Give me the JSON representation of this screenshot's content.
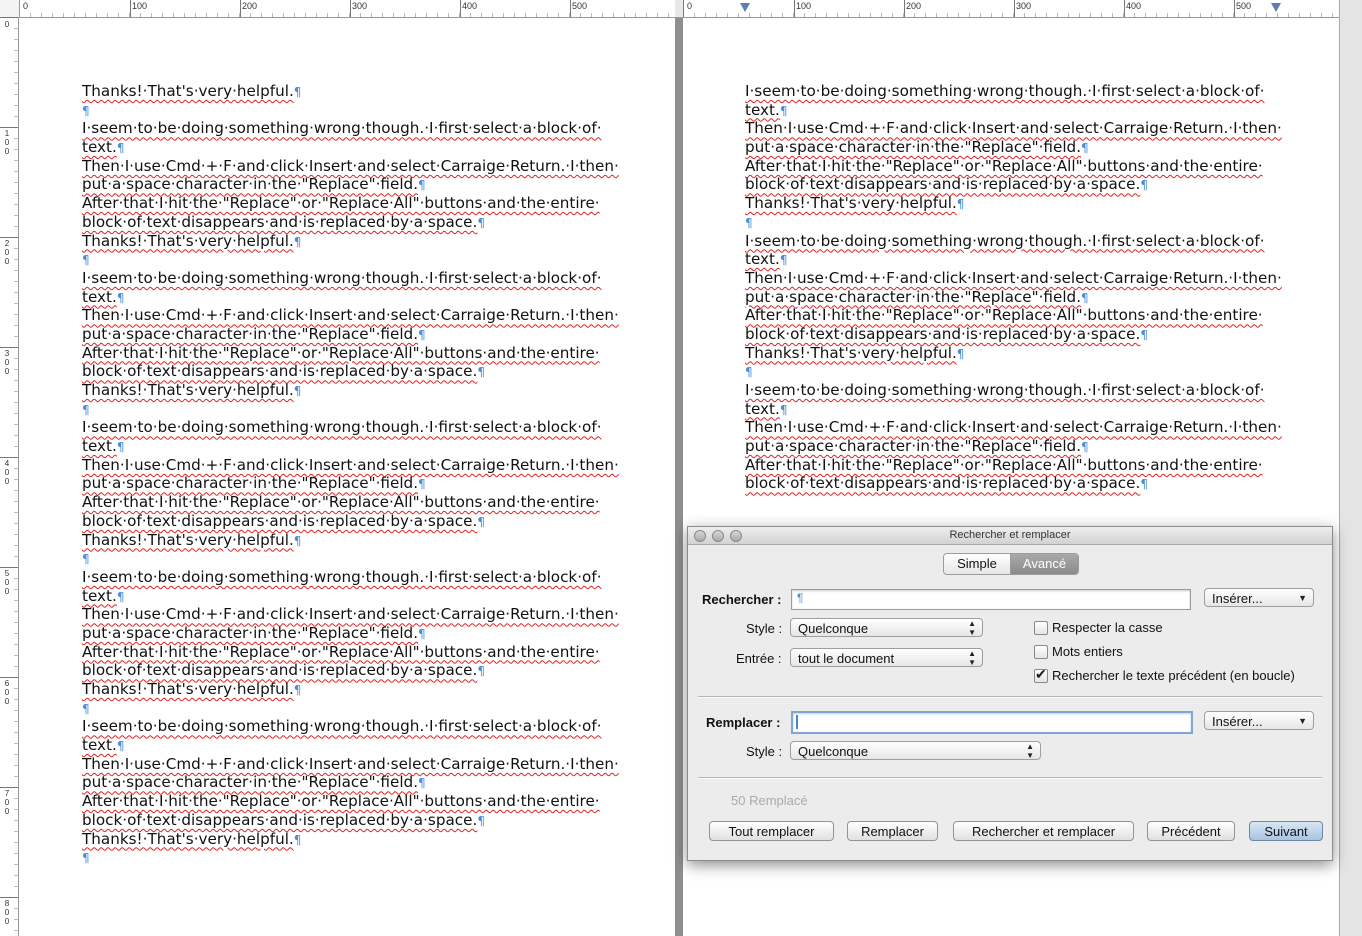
{
  "ruler_left": {
    "labels": [
      "0",
      "100",
      "200",
      "300",
      "400",
      "500"
    ]
  },
  "ruler_right": {
    "labels": [
      "0",
      "100",
      "200",
      "300",
      "400",
      "500"
    ]
  },
  "vertical_ruler": {
    "labels": [
      "0",
      "1\n0\n0",
      "2\n0\n0",
      "3\n0\n0",
      "4\n0\n0",
      "5\n0\n0",
      "6\n0\n0",
      "7\n0\n0",
      "8\n0\n0"
    ]
  },
  "left_page": {
    "lines": [
      "Thanks!·That's·very·helpful.",
      "",
      "I·seem·to·be·doing·something·wrong·though.·I·first·select·a·block·of·",
      "text.",
      "Then·I·use·Cmd·+·F·and·click·Insert·and·select·Carraige·Return.·I·then·",
      "put·a·space·character·in·the·\"Replace\"·field.",
      "After·that·I·hit·the·\"Replace\"·or·\"Replace·All\"·buttons·and·the·entire·",
      "block·of·text·disappears·and·is·replaced·by·a·space.",
      "Thanks!·That's·very·helpful.",
      "",
      "I·seem·to·be·doing·something·wrong·though.·I·first·select·a·block·of·",
      "text.",
      "Then·I·use·Cmd·+·F·and·click·Insert·and·select·Carraige·Return.·I·then·",
      "put·a·space·character·in·the·\"Replace\"·field.",
      "After·that·I·hit·the·\"Replace\"·or·\"Replace·All\"·buttons·and·the·entire·",
      "block·of·text·disappears·and·is·replaced·by·a·space.",
      "Thanks!·That's·very·helpful.",
      "",
      "I·seem·to·be·doing·something·wrong·though.·I·first·select·a·block·of·",
      "text.",
      "Then·I·use·Cmd·+·F·and·click·Insert·and·select·Carraige·Return.·I·then·",
      "put·a·space·character·in·the·\"Replace\"·field.",
      "After·that·I·hit·the·\"Replace\"·or·\"Replace·All\"·buttons·and·the·entire·",
      "block·of·text·disappears·and·is·replaced·by·a·space.",
      "Thanks!·That's·very·helpful.",
      "",
      "I·seem·to·be·doing·something·wrong·though.·I·first·select·a·block·of·",
      "text.",
      "Then·I·use·Cmd·+·F·and·click·Insert·and·select·Carraige·Return.·I·then·",
      "put·a·space·character·in·the·\"Replace\"·field.",
      "After·that·I·hit·the·\"Replace\"·or·\"Replace·All\"·buttons·and·the·entire·",
      "block·of·text·disappears·and·is·replaced·by·a·space.",
      "Thanks!·That's·very·helpful.",
      "",
      "I·seem·to·be·doing·something·wrong·though.·I·first·select·a·block·of·",
      "text.",
      "Then·I·use·Cmd·+·F·and·click·Insert·and·select·Carraige·Return.·I·then·",
      "put·a·space·character·in·the·\"Replace\"·field.",
      "After·that·I·hit·the·\"Replace\"·or·\"Replace·All\"·buttons·and·the·entire·",
      "block·of·text·disappears·and·is·replaced·by·a·space.",
      "Thanks!·That's·very·helpful.",
      ""
    ]
  },
  "right_page": {
    "lines": [
      "I·seem·to·be·doing·something·wrong·though.·I·first·select·a·block·of·",
      "text.",
      "Then·I·use·Cmd·+·F·and·click·Insert·and·select·Carraige·Return.·I·then·",
      "put·a·space·character·in·the·\"Replace\"·field.",
      "After·that·I·hit·the·\"Replace\"·or·\"Replace·All\"·buttons·and·the·entire·",
      "block·of·text·disappears·and·is·replaced·by·a·space.",
      "Thanks!·That's·very·helpful.",
      "",
      "I·seem·to·be·doing·something·wrong·though.·I·first·select·a·block·of·",
      "text.",
      "Then·I·use·Cmd·+·F·and·click·Insert·and·select·Carraige·Return.·I·then·",
      "put·a·space·character·in·the·\"Replace\"·field.",
      "After·that·I·hit·the·\"Replace\"·or·\"Replace·All\"·buttons·and·the·entire·",
      "block·of·text·disappears·and·is·replaced·by·a·space.",
      "Thanks!·That's·very·helpful.",
      "",
      "I·seem·to·be·doing·something·wrong·though.·I·first·select·a·block·of·",
      "text.",
      "Then·I·use·Cmd·+·F·and·click·Insert·and·select·Carraige·Return.·I·then·",
      "put·a·space·character·in·the·\"Replace\"·field.",
      "After·that·I·hit·the·\"Replace\"·or·\"Replace·All\"·buttons·and·the·entire·",
      "block·of·text·disappears·and·is·replaced·by·a·space."
    ]
  },
  "paragraph_mark": "¶",
  "dialog": {
    "title": "Rechercher et remplacer",
    "tabs": {
      "simple": "Simple",
      "advanced": "Avancé"
    },
    "search_label": "Rechercher :",
    "search_value": "¶",
    "insert_label": "Insérer...",
    "style_label": "Style :",
    "style_value": "Quelconque",
    "entry_label": "Entrée :",
    "entry_value": "tout le document",
    "match_case": "Respecter la casse",
    "whole_words": "Mots entiers",
    "wrap_search": "Rechercher le texte précédent (en boucle)",
    "replace_label": "Remplacer :",
    "replace_value": "",
    "replace_insert_label": "Insérer...",
    "replace_style_label": "Style :",
    "replace_style_value": "Quelconque",
    "status": "50 Remplacé",
    "buttons": {
      "replace_all": "Tout remplacer",
      "replace": "Remplacer",
      "find_replace": "Rechercher et remplacer",
      "previous": "Précédent",
      "next": "Suivant"
    }
  }
}
